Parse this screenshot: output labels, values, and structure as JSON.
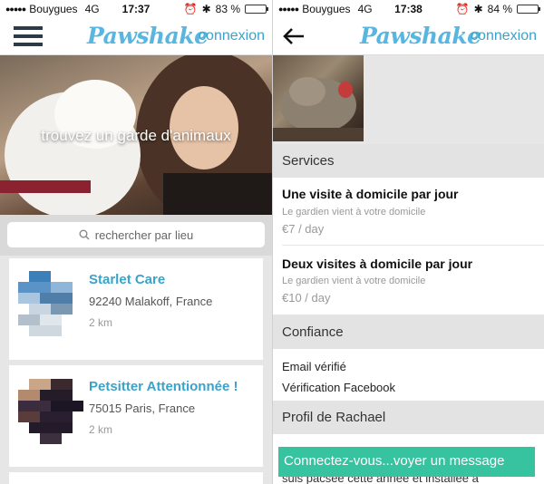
{
  "left_screen": {
    "status_bar": {
      "carrier": "Bouygues",
      "network": "4G",
      "time": "17:37",
      "battery": "83 %",
      "battery_level": 0.83
    },
    "header": {
      "logo": "Pawshake",
      "connexion_label": "connexion",
      "menu_icon": "hamburger-menu-icon"
    },
    "hero": {
      "tagline": "trouvez un garde d'animaux"
    },
    "search": {
      "placeholder": "rechercher par lieu",
      "icon": "search-icon"
    },
    "listings": [
      {
        "name": "Starlet Care",
        "address": "92240 Malakoff, France",
        "distance": "2 km"
      },
      {
        "name": "Petsitter Attentionnée !",
        "address": "75015 Paris, France",
        "distance": "2 km"
      }
    ]
  },
  "right_screen": {
    "status_bar": {
      "carrier": "Bouygues",
      "network": "4G",
      "time": "17:38",
      "battery": "84 %",
      "battery_level": 0.84
    },
    "header": {
      "logo": "Pawshake",
      "connexion_label": "connexion",
      "back_icon": "back-arrow-icon"
    },
    "sections": {
      "services": "Services",
      "trust": "Confiance",
      "profile": "Profil de Rachael"
    },
    "services": [
      {
        "title": "Une visite à domicile par jour",
        "description": "Le gardien vient à votre domicile",
        "price": "€7 / day"
      },
      {
        "title": "Deux visites à domicile par jour",
        "description": "Le gardien vient à votre domicile",
        "price": "€10 / day"
      }
    ],
    "trust_items": [
      "Email vérifié",
      "Vérification Facebook"
    ],
    "profile_text": "suis pacsée cette année et installée à",
    "cta_label": "Connectez-vous...voyer un message"
  },
  "colors": {
    "brand": "#58b6e0",
    "link": "#3aa3c9",
    "cta": "#37c2a0"
  }
}
